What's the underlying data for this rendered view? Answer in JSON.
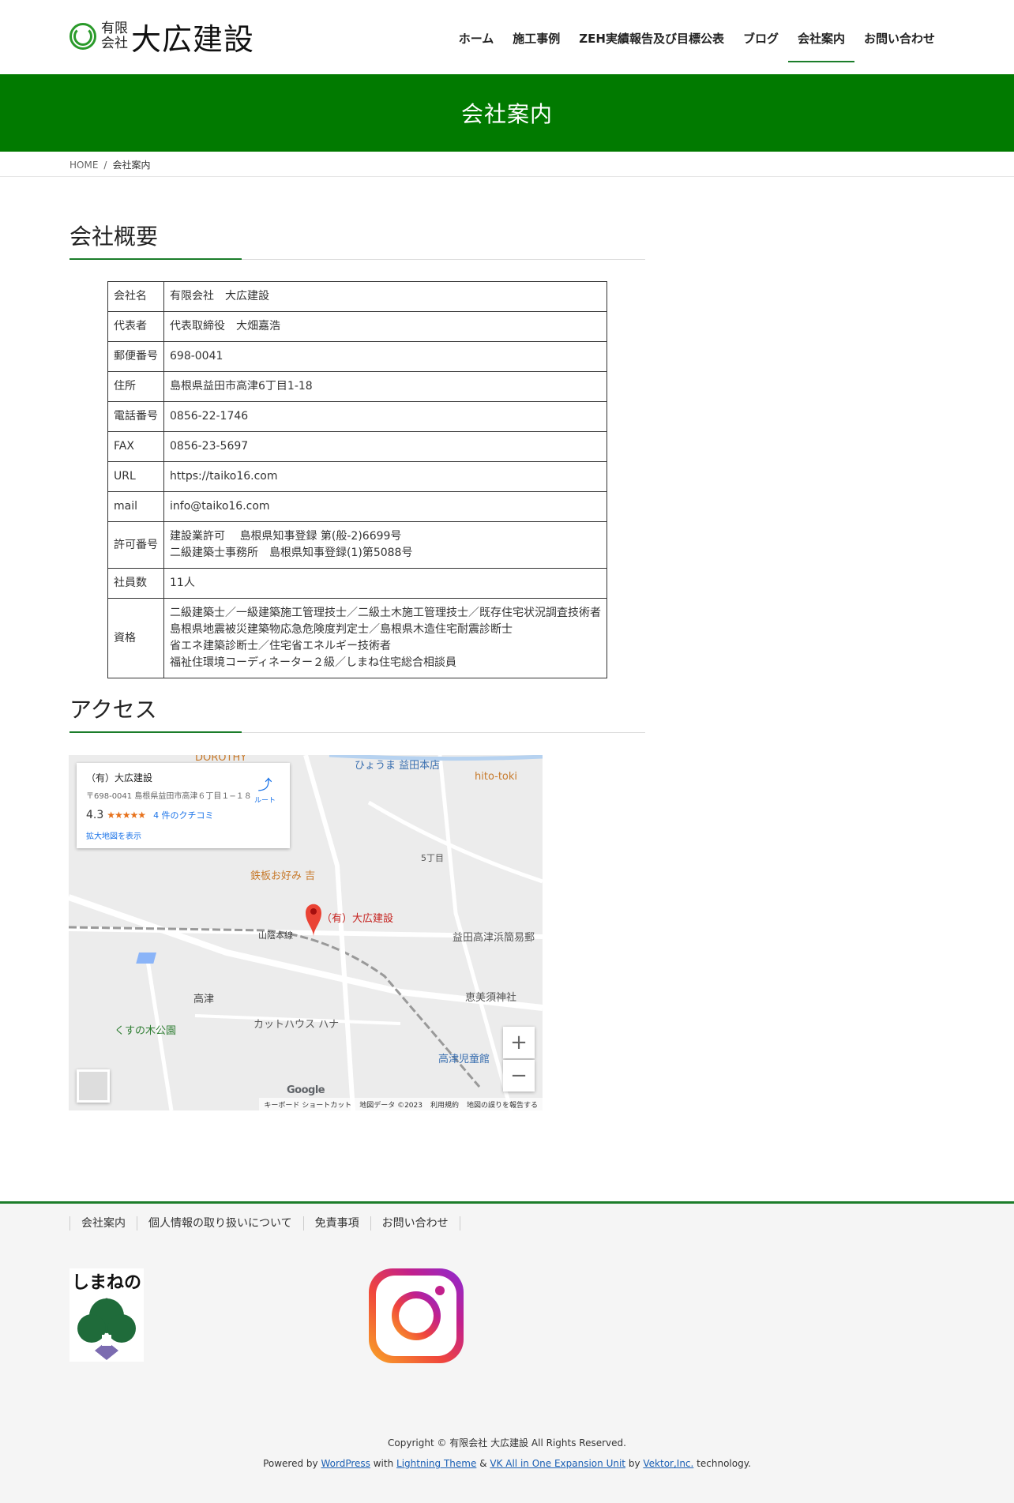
{
  "header": {
    "logo_small_top": "有限",
    "logo_small_bottom": "会社",
    "logo_name": "大広建設",
    "nav": [
      "ホーム",
      "施工事例",
      "ZEH実績報告及び目標公表",
      "ブログ",
      "会社案内",
      "お問い合わせ"
    ],
    "active_nav": "会社案内"
  },
  "page_title": "会社案内",
  "breadcrumb": {
    "home": "HOME",
    "sep": "/",
    "current": "会社案内"
  },
  "overview": {
    "heading": "会社概要",
    "rows": [
      {
        "label": "会社名",
        "value": "有限会社　大広建設"
      },
      {
        "label": "代表者",
        "value": "代表取締役　大畑嘉浩"
      },
      {
        "label": "郵便番号",
        "value": "698-0041"
      },
      {
        "label": "住所",
        "value": "島根県益田市高津6丁目1-18"
      },
      {
        "label": "電話番号",
        "value": "0856-22-1746"
      },
      {
        "label": "FAX",
        "value": "0856-23-5697"
      },
      {
        "label": "URL",
        "value": "https://taiko16.com"
      },
      {
        "label": "mail",
        "value": "info@taiko16.com"
      },
      {
        "label": "許可番号",
        "lines": [
          "建設業許可　 島根県知事登録 第(般-2)6699号",
          "二級建築士事務所　島根県知事登録(1)第5088号"
        ]
      },
      {
        "label": "社員数",
        "value": "11人"
      },
      {
        "label": "資格",
        "lines": [
          "二級建築士／一級建築施工管理技士／二級土木施工管理技士／既存住宅状況調査技術者",
          "島根県地震被災建築物応急危険度判定士／島根県木造住宅耐震診断士",
          "省エネ建築診断士／住宅省エネルギー技術者",
          "福祉住環境コーディネーター２級／しまね住宅総合相談員"
        ]
      }
    ]
  },
  "access": {
    "heading": "アクセス",
    "map": {
      "card_name": "（有）大広建設",
      "card_address": "〒698-0041 島根県益田市高津６丁目１−１８",
      "rating": "4.3",
      "stars": "★★★★★",
      "reviews": "4 件のクチコミ",
      "larger_map": "拡大地図を表示",
      "directions": "ルート",
      "labels": {
        "dorothy": "DOROTHY",
        "hyouma": "ひょうま 益田本店",
        "hitotoki": "hito-toki",
        "teppan": "鉄板お好み 吉",
        "chome5": "5丁目",
        "company": "（有）大広建設",
        "line": "山陰本線",
        "post": "益田高津浜簡易郵",
        "shrine": "恵美須神社",
        "takatsu": "高津",
        "cut": "カットハウス ハナ",
        "park": "くすの木公園",
        "kids": "高津児童館"
      },
      "zoom_in": "+",
      "zoom_out": "−",
      "google": "Google",
      "footer": [
        "キーボード ショートカット",
        "地図データ ©2023",
        "利用規約",
        "地図の誤りを報告する"
      ]
    }
  },
  "footer": {
    "nav": [
      "会社案内",
      "個人情報の取り扱いについて",
      "免責事項",
      "お問い合わせ"
    ],
    "shimane_text": "しまねの木",
    "copyright": "Copyright © 有限会社 大広建設 All Rights Reserved.",
    "powered": {
      "prefix": "Powered by",
      "wordpress": "WordPress",
      "with": "with",
      "lightning": "Lightning Theme",
      "amp": "&",
      "vk": "VK All in One Expansion Unit",
      "by": "by",
      "vektor": "Vektor,Inc.",
      "suffix": "technology."
    }
  },
  "colors": {
    "brand_green": "#017a00",
    "accent_green": "#1b7d2a",
    "link_blue": "#1a5fb4"
  }
}
